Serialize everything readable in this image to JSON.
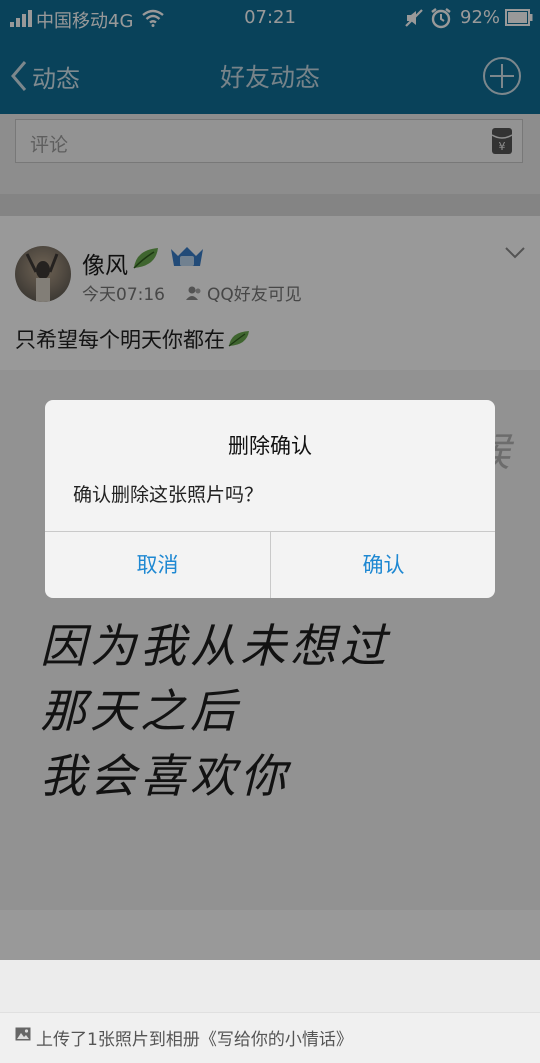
{
  "status_bar": {
    "carrier": "中国移动4G",
    "time": "07:21",
    "battery": "92%",
    "icons": [
      "signal-icon",
      "wifi-icon",
      "mute-icon",
      "alarm-icon",
      "battery-icon"
    ]
  },
  "nav": {
    "back_label": "动态",
    "title": "好友动态",
    "add_icon": "plus-circle-icon"
  },
  "comment": {
    "placeholder": "评论"
  },
  "post": {
    "username": "像风",
    "time": "今天07:16",
    "visibility": "QQ好友可见",
    "text": "只希望每个明天你都在",
    "photo_lines": [
      "因为我从未想过",
      "那天之后",
      "我会喜欢你"
    ],
    "photo_top_right": "候",
    "upload_info": "上传了1张照片到相册《写给你的小情话》"
  },
  "dialog": {
    "title": "删除确认",
    "message": "确认删除这张照片吗？",
    "cancel": "取消",
    "confirm": "确认"
  },
  "colors": {
    "header": "#0f6e97",
    "dialog_button": "#1e88d2"
  }
}
